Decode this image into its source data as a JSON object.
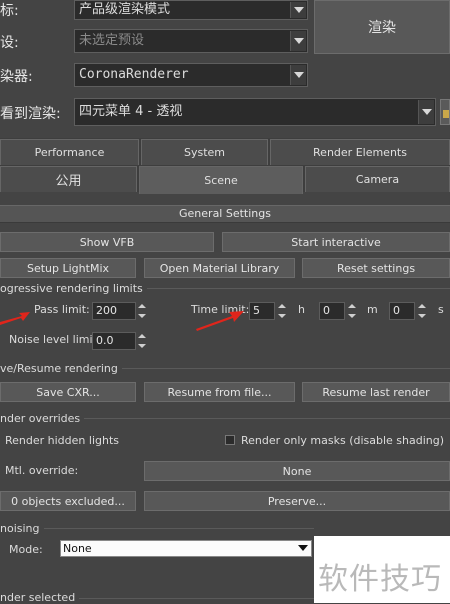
{
  "top": {
    "target_label": "标:",
    "target_value": "产品级渲染模式",
    "preset_label": "设:",
    "preset_value": "未选定预设",
    "renderer_label": "染器:",
    "renderer_value": "CoronaRenderer",
    "view_label": "看到渲染:",
    "view_value": "四元菜单 4 - 透视",
    "render_button": "渲染"
  },
  "tabs": {
    "row1": [
      "Performance",
      "System",
      "Render Elements"
    ],
    "row2": [
      "公用",
      "Scene",
      "Camera"
    ]
  },
  "general_settings": {
    "title": "General Settings",
    "show_vfb": "Show VFB",
    "start_interactive": "Start interactive",
    "setup_lightmix": "Setup LightMix",
    "open_material_library": "Open Material Library",
    "reset_settings": "Reset settings"
  },
  "progressive": {
    "title": "ogressive rendering limits",
    "pass_limit_label": "Pass limit:",
    "pass_limit_value": "200",
    "time_limit_label": "Time limit:",
    "hours_value": "5",
    "hours_unit": "h",
    "minutes_value": "0",
    "minutes_unit": "m",
    "seconds_value": "0",
    "seconds_unit": "s",
    "noise_level_label": "Noise level limit:",
    "noise_level_value": "0.0"
  },
  "save_resume": {
    "title": "ve/Resume rendering",
    "save_cxr": "Save CXR...",
    "resume_from_file": "Resume from file...",
    "resume_last_render": "Resume last render"
  },
  "overrides": {
    "title": "nder overrides",
    "render_hidden_lights": "Render hidden lights",
    "render_only_masks": "Render only masks (disable shading)",
    "mtl_override_label": "Mtl. override:",
    "mtl_override_value": "None",
    "objects_excluded": "0 objects excluded...",
    "preserve": "Preserve..."
  },
  "denoising": {
    "title": "noising",
    "mode_label": "Mode:",
    "mode_value": "None"
  },
  "bottom": {
    "render_selected": "nder selected"
  },
  "watermark": "软件技巧"
}
